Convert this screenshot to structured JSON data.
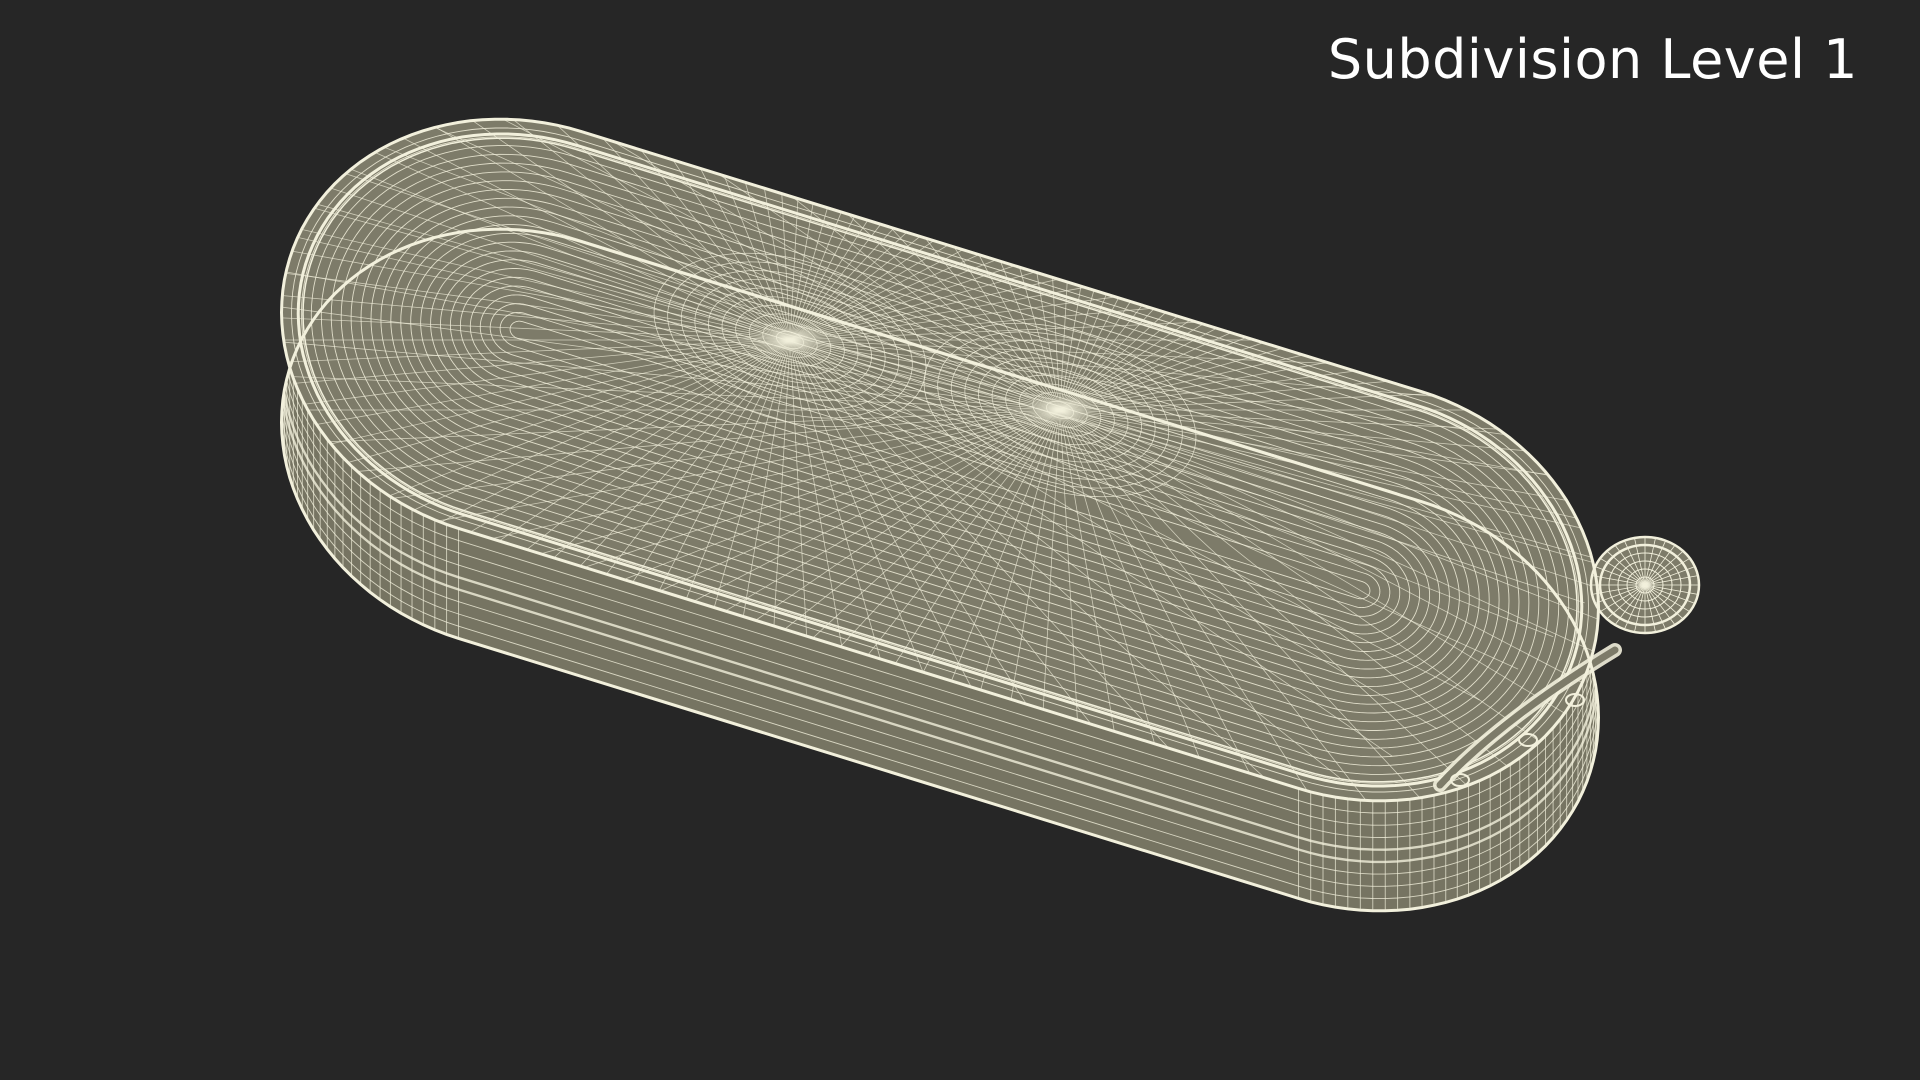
{
  "overlay": {
    "label": "Subdivision Level 1"
  },
  "render": {
    "object": "rounded-capsule-device-wireframe",
    "mode": "wireframe",
    "background_color": "#262626",
    "surface_color": "#7d7b69",
    "wire_color": "#f2f0dc",
    "label_color": "#ffffff",
    "features": [
      "circular-button",
      "slot-with-holes",
      "raised-rim"
    ]
  }
}
